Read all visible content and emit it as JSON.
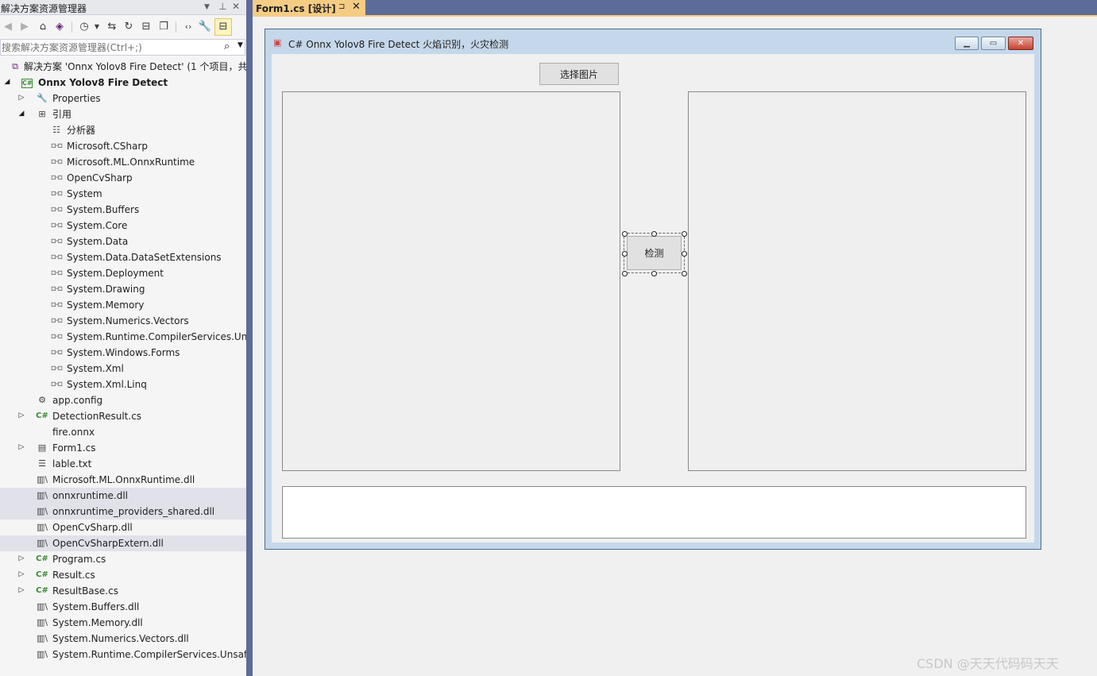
{
  "solution_explorer": {
    "title": "解决方案资源管理器",
    "search_placeholder": "搜索解决方案资源管理器(Ctrl+;)",
    "tree": [
      {
        "label": "解决方案 'Onnx Yolov8 Fire Detect' (1 个项目，共",
        "icon": "solution-icon",
        "expand": "",
        "level": 0
      },
      {
        "label": "Onnx Yolov8 Fire Detect",
        "icon": "csharp-project-icon",
        "expand": "expanded",
        "level": 0,
        "bold": true
      },
      {
        "label": "Properties",
        "icon": "wrench-icon",
        "expand": "collapsed",
        "level": 1
      },
      {
        "label": "引用",
        "icon": "references-icon",
        "expand": "expanded",
        "level": 1
      },
      {
        "label": "分析器",
        "icon": "analyzer-icon",
        "expand": "",
        "level": 2
      },
      {
        "label": "Microsoft.CSharp",
        "icon": "reference-icon",
        "expand": "",
        "level": 2
      },
      {
        "label": "Microsoft.ML.OnnxRuntime",
        "icon": "reference-icon",
        "expand": "",
        "level": 2
      },
      {
        "label": "OpenCvSharp",
        "icon": "reference-icon",
        "expand": "",
        "level": 2
      },
      {
        "label": "System",
        "icon": "reference-icon",
        "expand": "",
        "level": 2
      },
      {
        "label": "System.Buffers",
        "icon": "reference-icon",
        "expand": "",
        "level": 2
      },
      {
        "label": "System.Core",
        "icon": "reference-icon",
        "expand": "",
        "level": 2
      },
      {
        "label": "System.Data",
        "icon": "reference-icon",
        "expand": "",
        "level": 2
      },
      {
        "label": "System.Data.DataSetExtensions",
        "icon": "reference-icon",
        "expand": "",
        "level": 2
      },
      {
        "label": "System.Deployment",
        "icon": "reference-icon",
        "expand": "",
        "level": 2
      },
      {
        "label": "System.Drawing",
        "icon": "reference-icon",
        "expand": "",
        "level": 2
      },
      {
        "label": "System.Memory",
        "icon": "reference-icon",
        "expand": "",
        "level": 2
      },
      {
        "label": "System.Numerics.Vectors",
        "icon": "reference-icon",
        "expand": "",
        "level": 2
      },
      {
        "label": "System.Runtime.CompilerServices.Unsa",
        "icon": "reference-icon",
        "expand": "",
        "level": 2
      },
      {
        "label": "System.Windows.Forms",
        "icon": "reference-icon",
        "expand": "",
        "level": 2
      },
      {
        "label": "System.Xml",
        "icon": "reference-icon",
        "expand": "",
        "level": 2
      },
      {
        "label": "System.Xml.Linq",
        "icon": "reference-icon",
        "expand": "",
        "level": 2
      },
      {
        "label": "app.config",
        "icon": "config-icon",
        "expand": "",
        "level": 1
      },
      {
        "label": "DetectionResult.cs",
        "icon": "csharp-file-icon",
        "expand": "collapsed",
        "level": 1
      },
      {
        "label": "fire.onnx",
        "icon": "",
        "expand": "",
        "level": 1
      },
      {
        "label": "Form1.cs",
        "icon": "form-icon",
        "expand": "collapsed",
        "level": 1
      },
      {
        "label": "lable.txt",
        "icon": "text-file-icon",
        "expand": "",
        "level": 1
      },
      {
        "label": "Microsoft.ML.OnnxRuntime.dll",
        "icon": "library-icon",
        "expand": "",
        "level": 1
      },
      {
        "label": "onnxruntime.dll",
        "icon": "library-icon",
        "expand": "",
        "level": 1,
        "highlight": true
      },
      {
        "label": "onnxruntime_providers_shared.dll",
        "icon": "library-icon",
        "expand": "",
        "level": 1,
        "highlight": true
      },
      {
        "label": "OpenCvSharp.dll",
        "icon": "library-icon",
        "expand": "",
        "level": 1
      },
      {
        "label": "OpenCvSharpExtern.dll",
        "icon": "library-icon",
        "expand": "",
        "level": 1,
        "highlight": true
      },
      {
        "label": "Program.cs",
        "icon": "csharp-file-icon",
        "expand": "collapsed",
        "level": 1
      },
      {
        "label": "Result.cs",
        "icon": "csharp-file-icon",
        "expand": "collapsed",
        "level": 1
      },
      {
        "label": "ResultBase.cs",
        "icon": "csharp-file-icon",
        "expand": "collapsed",
        "level": 1
      },
      {
        "label": "System.Buffers.dll",
        "icon": "library-icon",
        "expand": "",
        "level": 1
      },
      {
        "label": "System.Memory.dll",
        "icon": "library-icon",
        "expand": "",
        "level": 1
      },
      {
        "label": "System.Numerics.Vectors.dll",
        "icon": "library-icon",
        "expand": "",
        "level": 1
      },
      {
        "label": "System.Runtime.CompilerServices.Unsafe.d",
        "icon": "library-icon",
        "expand": "",
        "level": 1
      }
    ]
  },
  "editor_tab": {
    "label": "Form1.cs [设计]"
  },
  "form": {
    "title": "C# Onnx Yolov8 Fire Detect 火焰识别，火灾检测",
    "select_image_label": "选择图片",
    "detect_label": "检测"
  },
  "watermark": "CSDN @天天代码码天天"
}
